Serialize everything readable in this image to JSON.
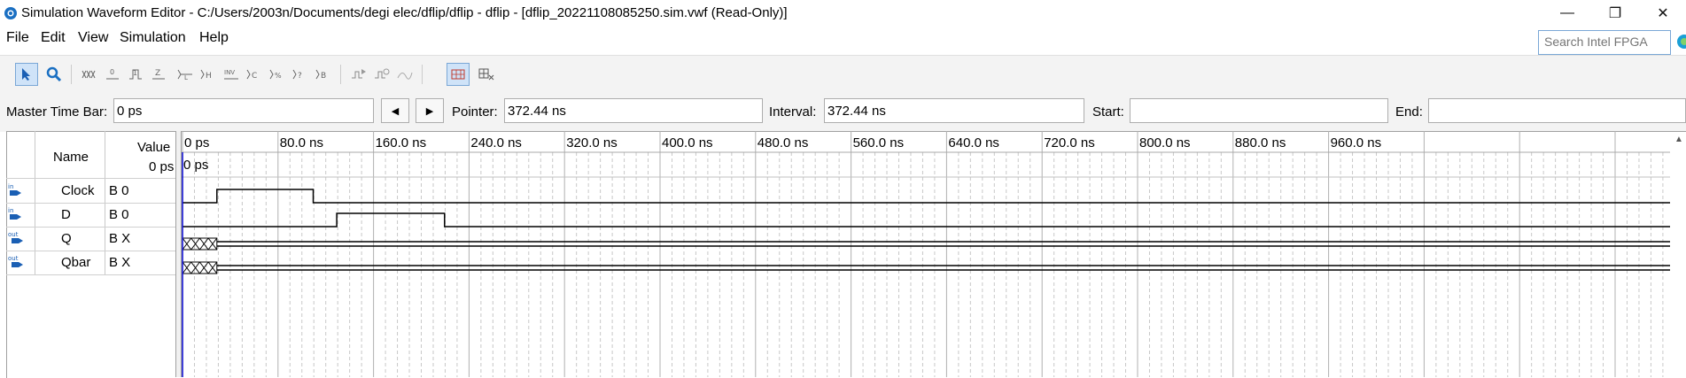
{
  "window": {
    "title": "Simulation Waveform Editor - C:/Users/2003n/Documents/degi elec/dflip/dflip - dflip - [dflip_20221108085250.sim.vwf (Read-Only)]",
    "minimize": "—",
    "maximize": "❐",
    "close": "✕"
  },
  "menu": {
    "file": "File",
    "edit": "Edit",
    "view": "View",
    "simulation": "Simulation",
    "help": "Help"
  },
  "search": {
    "placeholder": "Search Intel FPGA"
  },
  "timebar": {
    "master_label": "Master Time Bar:",
    "master_value": "0 ps",
    "pointer_label": "Pointer:",
    "pointer_value": "372.44 ns",
    "interval_label": "Interval:",
    "interval_value": "372.44 ns",
    "start_label": "Start:",
    "start_value": "",
    "end_label": "End:",
    "end_value": "",
    "prev_glyph": "◀",
    "next_glyph": "▶"
  },
  "table": {
    "col_name": "Name",
    "col_value": "Value",
    "value_time": "0 ps",
    "cursor_label": "0 ps",
    "time_ticks": [
      "0 ps",
      "80.0 ns",
      "160.0 ns",
      "240.0 ns",
      "320.0 ns",
      "400.0 ns",
      "480.0 ns",
      "560.0 ns",
      "640.0 ns",
      "720.0 ns",
      "800.0 ns",
      "880.0 ns",
      "960.0 ns"
    ],
    "signals": [
      {
        "direction": "in",
        "name": "Clock",
        "value": "B 0"
      },
      {
        "direction": "in",
        "name": "D",
        "value": "B 0"
      },
      {
        "direction": "out",
        "name": "Q",
        "value": "B X"
      },
      {
        "direction": "out",
        "name": "Qbar",
        "value": "B X"
      }
    ]
  },
  "waveforms": {
    "time_unit": "ns",
    "clock_high": [
      [
        28.8,
        109.5
      ]
    ],
    "d_high": [
      [
        129.2,
        219.5
      ]
    ],
    "q_unknown_until": 28.8,
    "qbar_unknown_until": 28.8
  },
  "colors": {
    "cursor": "#0000cc",
    "accent": "#0078d7"
  }
}
